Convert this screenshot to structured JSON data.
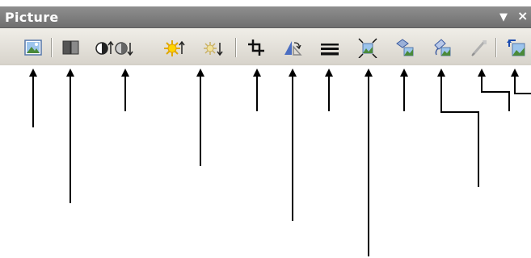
{
  "toolbar": {
    "title": "Picture",
    "dropdown_glyph": "▼",
    "close_glyph": "×"
  },
  "buttons": [
    {
      "name": "insert-picture-button",
      "icon": "picture-icon"
    },
    {
      "name": "color-button",
      "icon": "color-mode-icon"
    },
    {
      "name": "more-contrast-button",
      "icon": "more-contrast-icon"
    },
    {
      "name": "less-contrast-button",
      "icon": "less-contrast-icon"
    },
    {
      "name": "more-brightness-button",
      "icon": "more-brightness-icon"
    },
    {
      "name": "less-brightness-button",
      "icon": "less-brightness-icon"
    },
    {
      "name": "crop-button",
      "icon": "crop-icon"
    },
    {
      "name": "rotate-left-button",
      "icon": "rotate-left-icon"
    },
    {
      "name": "line-style-button",
      "icon": "line-style-icon"
    },
    {
      "name": "compress-pictures-button",
      "icon": "compress-icon"
    },
    {
      "name": "text-wrapping-button",
      "icon": "text-wrapping-icon"
    },
    {
      "name": "format-picture-button",
      "icon": "format-picture-icon"
    },
    {
      "name": "set-transparent-color-button",
      "icon": "transparent-color-icon"
    },
    {
      "name": "reset-picture-button",
      "icon": "reset-picture-icon"
    }
  ],
  "colors": {
    "title_bar": "#808080",
    "toolbar_bg": "#e8e6e0",
    "arrow": "#000000"
  }
}
